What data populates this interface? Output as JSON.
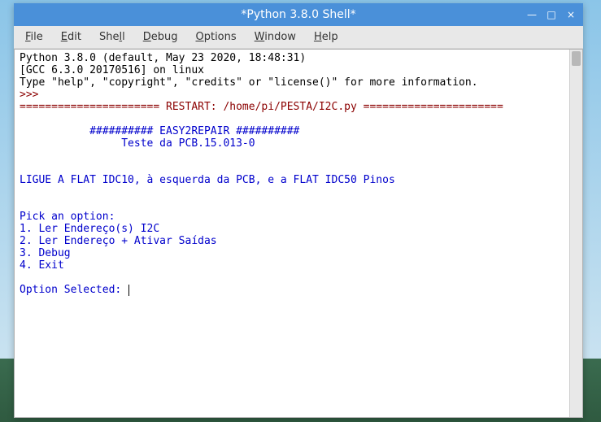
{
  "window": {
    "title": "*Python 3.8.0 Shell*"
  },
  "menu": {
    "file": "File",
    "edit": "Edit",
    "shell": "Shell",
    "debug": "Debug",
    "options": "Options",
    "window": "Window",
    "help": "Help"
  },
  "shell": {
    "interp_line1": "Python 3.8.0 (default, May 23 2020, 18:48:31)",
    "interp_line2": "[GCC 6.3.0 20170516] on linux",
    "interp_line3": "Type \"help\", \"copyright\", \"credits\" or \"license()\" for more information.",
    "prompt": ">>> ",
    "restart_banner": "====================== RESTART: /home/pi/PESTA/I2C.py ======================",
    "banner1": "           ########## EASY2REPAIR ##########",
    "banner2": "                Teste da PCB.15.013-0",
    "instruction": "LIGUE A FLAT IDC10, à esquerda da PCB, e a FLAT IDC50 Pinos",
    "pick": "Pick an option:",
    "opt1": "1. Ler Endereço(s) I2C",
    "opt2": "2. Ler Endereço + Ativar Saídas",
    "opt3": "3. Debug",
    "opt4": "4. Exit",
    "selected_label": "Option Selected: "
  },
  "controls": {
    "min": "—",
    "max": "□",
    "close": "×"
  }
}
